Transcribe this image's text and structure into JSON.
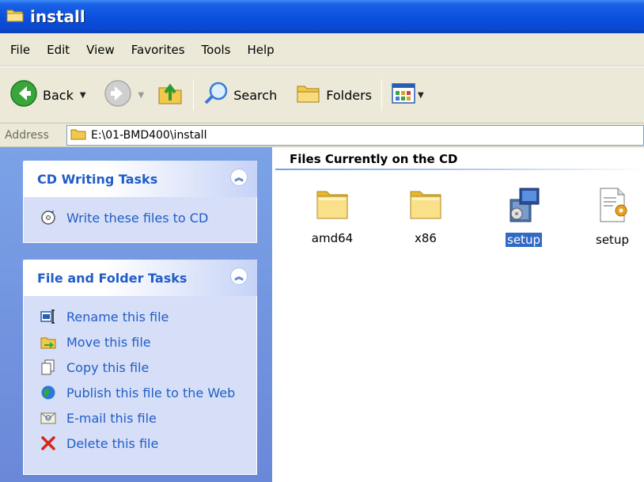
{
  "window": {
    "title": "install"
  },
  "menu": [
    "File",
    "Edit",
    "View",
    "Favorites",
    "Tools",
    "Help"
  ],
  "toolbar": {
    "back": "Back",
    "search": "Search",
    "folders": "Folders"
  },
  "address": {
    "label": "Address",
    "path": "E:\\01-BMD400\\install"
  },
  "taskpane": {
    "cd_group": {
      "title": "CD Writing Tasks",
      "tasks": [
        "Write these files to CD"
      ]
    },
    "file_group": {
      "title": "File and Folder Tasks",
      "tasks": [
        "Rename this file",
        "Move this file",
        "Copy this file",
        "Publish this file to the Web",
        "E-mail this file",
        "Delete this file"
      ]
    }
  },
  "content": {
    "section_title": "Files Currently on the CD",
    "items": [
      {
        "name": "amd64",
        "icon": "folder-icon",
        "selected": false
      },
      {
        "name": "x86",
        "icon": "folder-icon",
        "selected": false
      },
      {
        "name": "setup",
        "icon": "installer-icon",
        "selected": true
      },
      {
        "name": "setup",
        "icon": "settings-file-icon",
        "selected": false
      }
    ]
  },
  "colors": {
    "titlebar": "#0a4fdc",
    "taskpane": "#7ba2e7",
    "link": "#215dc6",
    "selection": "#316ac5"
  }
}
